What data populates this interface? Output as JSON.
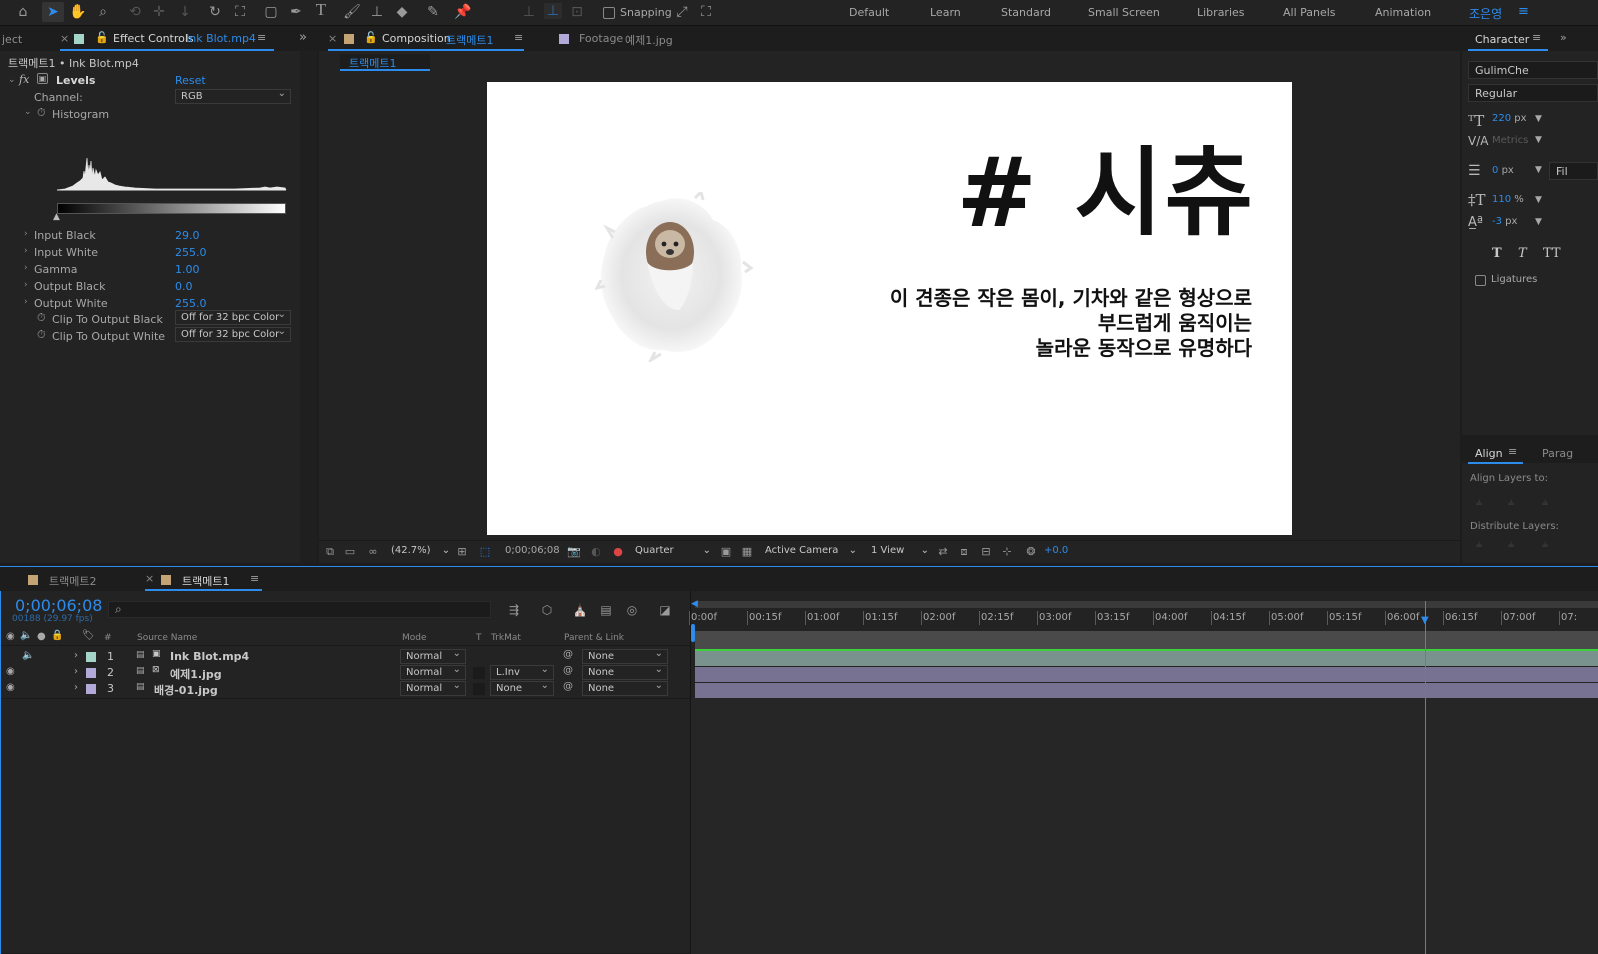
{
  "toolbar": {
    "snapping_label": "Snapping",
    "workspaces": [
      "Default",
      "Learn",
      "Standard",
      "Small Screen",
      "Libraries",
      "All Panels",
      "Animation"
    ],
    "user": "조은영"
  },
  "effect_panel": {
    "left_tab": "ject",
    "tab_label": "Effect Controls",
    "tab_file": "Ink Blot.mp4",
    "breadcrumb": "트랙메트1 • Ink Blot.mp4",
    "effect_name": "Levels",
    "reset_label": "Reset",
    "channel_label": "Channel:",
    "channel_value": "RGB",
    "histogram_label": "Histogram",
    "props": [
      {
        "label": "Input Black",
        "value": "29.0"
      },
      {
        "label": "Input White",
        "value": "255.0"
      },
      {
        "label": "Gamma",
        "value": "1.00"
      },
      {
        "label": "Output Black",
        "value": "0.0"
      },
      {
        "label": "Output White",
        "value": "255.0"
      }
    ],
    "clip_black_label": "Clip To Output Black",
    "clip_black_value": "Off for 32 bpc Color",
    "clip_white_label": "Clip To Output White",
    "clip_white_value": "Off for 32 bpc Color"
  },
  "comp_panel": {
    "tab_label": "Composition",
    "tab_name": "트랙메트1",
    "footage_label": "Footage",
    "footage_name": "예제1.jpg",
    "sub_tab": "트랙메트1",
    "title": "# 시츄",
    "subtitle_lines": [
      "이 견종은 작은 몸이, 기차와 같은 형상으로",
      "부드럽게 움직이는",
      "놀라운 동작으로 유명하다"
    ],
    "zoom": "(42.7%)",
    "timecode": "0;00;06;08",
    "resolution": "Quarter",
    "camera": "Active Camera",
    "views": "1 View",
    "exposure": "+0.0"
  },
  "character_panel": {
    "title": "Character",
    "font": "GulimChe",
    "style": "Regular",
    "size_value": "220",
    "size_unit": "px",
    "kerning": "Metrics",
    "leading_value": "0",
    "leading_unit": "px",
    "fill_label": "Fil",
    "scale_value": "110",
    "scale_unit": "%",
    "baseline_value": "-3",
    "baseline_unit": "px",
    "ligatures_label": "Ligatures"
  },
  "align_panel": {
    "title": "Align",
    "paragraph_tab": "Parag",
    "align_layers_label": "Align Layers to:",
    "distribute_label": "Distribute Layers:"
  },
  "timeline": {
    "tabs": [
      "트랙메트2",
      "트랙메트1"
    ],
    "timecode": "0;00;06;08",
    "frames": "00188 (29.97 fps)",
    "columns": {
      "number": "#",
      "source": "Source Name",
      "mode": "Mode",
      "t": "T",
      "trkmat": "TrkMat",
      "parent": "Parent & Link"
    },
    "layers": [
      {
        "num": "1",
        "name": "Ink Blot.mp4",
        "mode": "Normal",
        "trkmat": "",
        "parent": "None",
        "color": "#a4d4c8"
      },
      {
        "num": "2",
        "name": "예제1.jpg",
        "mode": "Normal",
        "trkmat": "L.Inv",
        "parent": "None",
        "color": "#b2a9d8"
      },
      {
        "num": "3",
        "name": "배경-01.jpg",
        "mode": "Normal",
        "trkmat": "None",
        "parent": "None",
        "color": "#b2a9d8"
      }
    ],
    "ruler": [
      "0:00f",
      "00:15f",
      "01:00f",
      "01:15f",
      "02:00f",
      "02:15f",
      "03:00f",
      "03:15f",
      "04:00f",
      "04:15f",
      "05:00f",
      "05:15f",
      "06:00f",
      "06:15f",
      "07:00f",
      "07:"
    ],
    "playhead_fraction": 0.844
  }
}
